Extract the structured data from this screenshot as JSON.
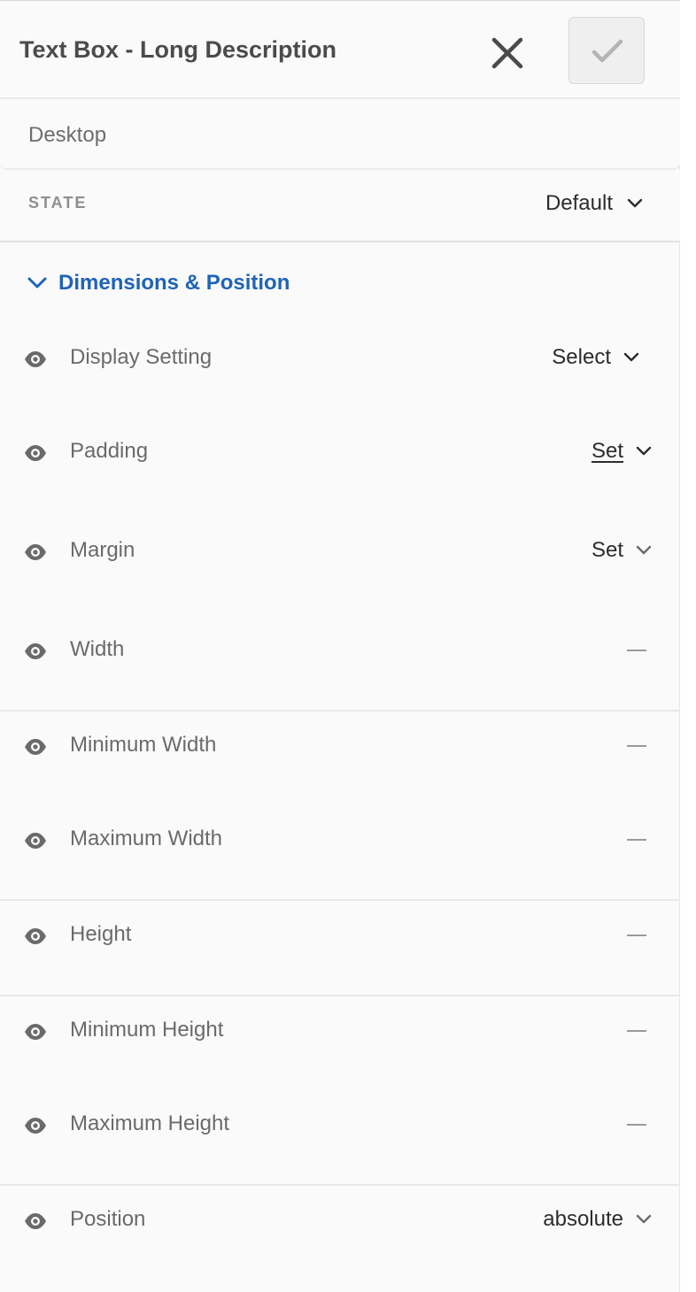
{
  "header": {
    "title": "Text Box - Long Description",
    "close_icon": "close-icon",
    "confirm_icon": "checkmark-icon"
  },
  "device": {
    "label": "Desktop"
  },
  "state": {
    "label": "STATE",
    "value": "Default"
  },
  "section": {
    "title": "Dimensions & Position",
    "expanded": true,
    "accent_color": "#1f63b8"
  },
  "properties": [
    {
      "label": "Display Setting",
      "value": "Select",
      "control": "dropdown"
    },
    {
      "label": "Padding",
      "value": "Set",
      "control": "dropdown-underlined"
    },
    {
      "label": "Margin",
      "value": "Set",
      "control": "dropdown"
    },
    {
      "label": "Width",
      "value": "",
      "control": "dash"
    },
    {
      "label": "Minimum Width",
      "value": "",
      "control": "dash"
    },
    {
      "label": "Maximum Width",
      "value": "",
      "control": "dash"
    },
    {
      "label": "Height",
      "value": "",
      "control": "dash"
    },
    {
      "label": "Minimum Height",
      "value": "",
      "control": "dash"
    },
    {
      "label": "Maximum Height",
      "value": "",
      "control": "dash"
    },
    {
      "label": "Position",
      "value": "absolute",
      "control": "dropdown"
    }
  ]
}
